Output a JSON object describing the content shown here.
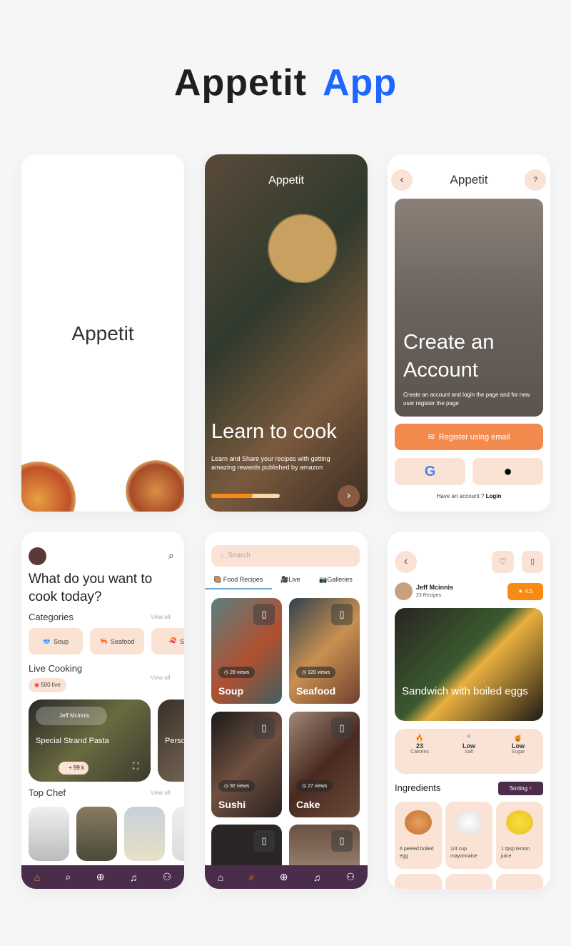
{
  "title": {
    "part1": "Appetit",
    "part2": "App"
  },
  "colors": {
    "accent": "#1e66ff",
    "orange": "#f28a4e",
    "peach": "#fae2d5",
    "plum": "#4a2c4b",
    "star": "#f98a12"
  },
  "splash": {
    "logo": "Appetit"
  },
  "onboarding": {
    "logo": "Appetit",
    "heading": "Learn to cook",
    "body": "Learn and Share your recipes with getting amazing rewards published by amazon",
    "progress": 0.6,
    "next_icon": "chevron-right-icon"
  },
  "register": {
    "title": "Appetit",
    "hero_title": "Create an Account",
    "hero_body": "Create an account and login the page and for new user register the page",
    "email_button": "Register using email",
    "google": "G",
    "have_account": "Have an account ?",
    "login": "Login"
  },
  "home": {
    "question": "What do you want to cook today?",
    "categories_label": "Categories",
    "view_all": "View all",
    "categories": [
      {
        "label": "Soup"
      },
      {
        "label": "Seafood"
      },
      {
        "label": "Su"
      }
    ],
    "live_label": "Live Cooking",
    "live_badge": "500 live",
    "live_cards": [
      {
        "chef": "Jeff Mcinnis",
        "title": "Special Strand Pasta",
        "viewers": "+ 99 k"
      },
      {
        "title": "Perso"
      }
    ],
    "top_chef": "Top Chef"
  },
  "search": {
    "placeholder": "Search",
    "tabs": [
      {
        "label": "Food Recipes"
      },
      {
        "label": "Live"
      },
      {
        "label": "Galleries"
      }
    ],
    "cards": [
      {
        "name": "Soup",
        "views": "28 views"
      },
      {
        "name": "Seafood",
        "views": "120 views"
      },
      {
        "name": "Sushi",
        "views": "92 views"
      },
      {
        "name": "Cake",
        "views": "27 views"
      }
    ]
  },
  "detail": {
    "chef": "Jeff Mcinnis",
    "recipes": "23 Recipes",
    "rating": "4.5",
    "dish": "Sandwich with boiled eggs",
    "stats": [
      {
        "value": "23",
        "label": "Calories"
      },
      {
        "value": "Low",
        "label": "Salt"
      },
      {
        "value": "Low",
        "label": "Sugar"
      }
    ],
    "ingredients_label": "Ingredients",
    "sorting": "Sorting",
    "ingredients": [
      {
        "text": "6 peeled boiled egg"
      },
      {
        "text": "1/4 cup mayonnaise"
      },
      {
        "text": "1 tpsp lemon juice"
      }
    ]
  },
  "nav": {
    "icons": [
      "home-icon",
      "search-icon",
      "add-icon",
      "bell-icon",
      "profile-icon"
    ]
  }
}
